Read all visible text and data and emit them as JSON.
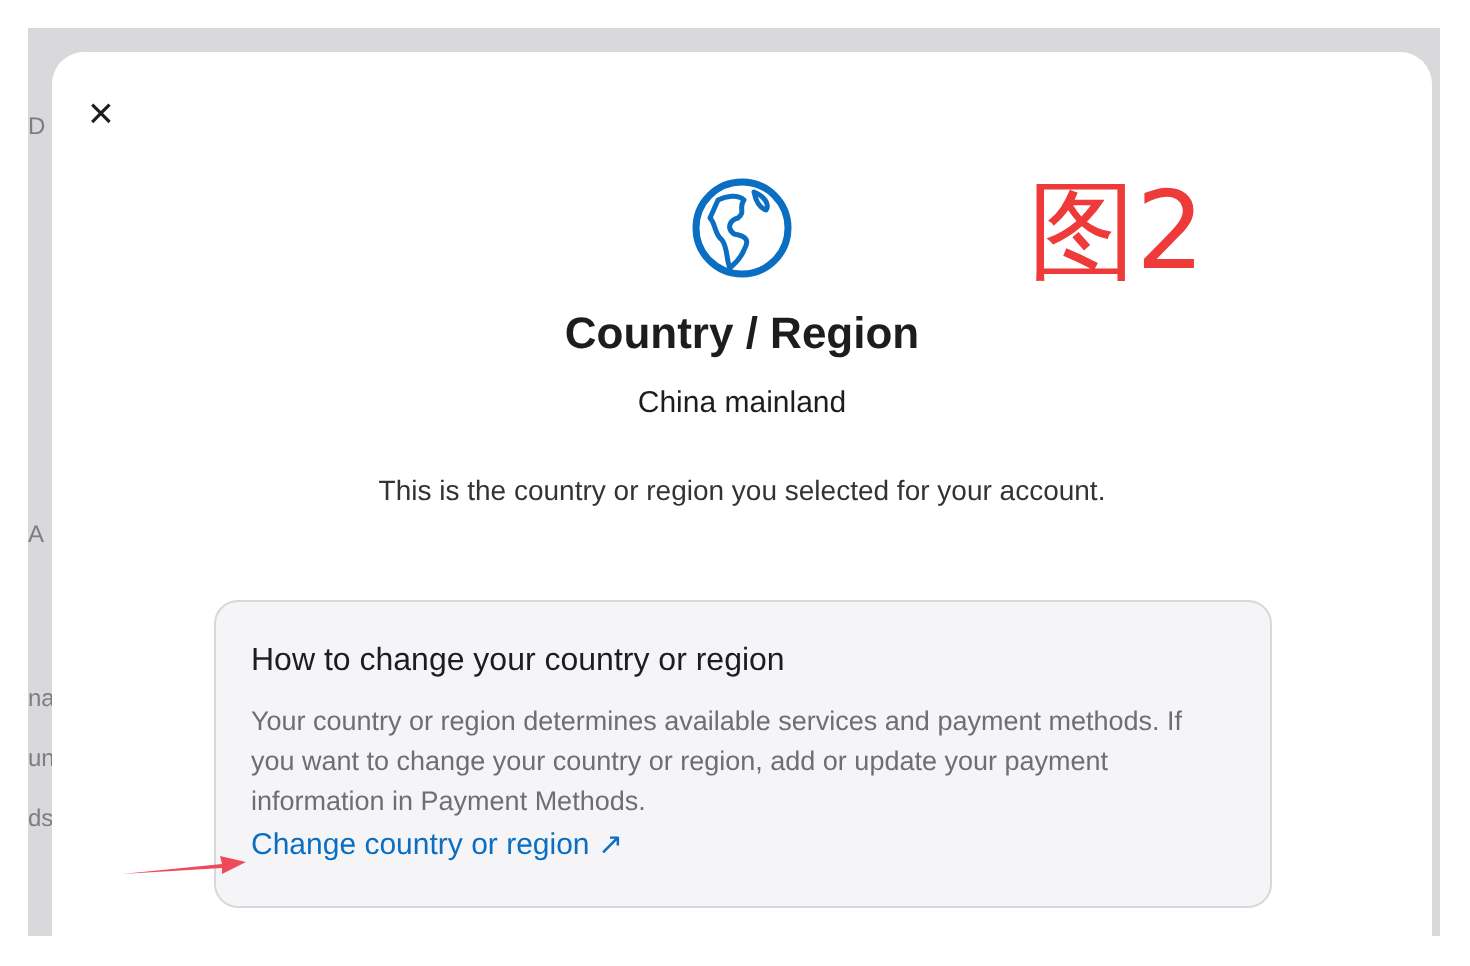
{
  "backdrop_fragments": [
    "D",
    "A",
    "na",
    "un",
    "ds"
  ],
  "dialog": {
    "close": "×",
    "title": "Country / Region",
    "value": "China mainland",
    "description": "This is the country or region you selected for your account.",
    "info": {
      "heading": "How to change your country or region",
      "body": "Your country or region determines available services and payment methods. If you want to change your country or region, add or update your payment information in Payment Methods.",
      "link": "Change country or region ↗"
    }
  },
  "annotation": {
    "label": "图2"
  }
}
